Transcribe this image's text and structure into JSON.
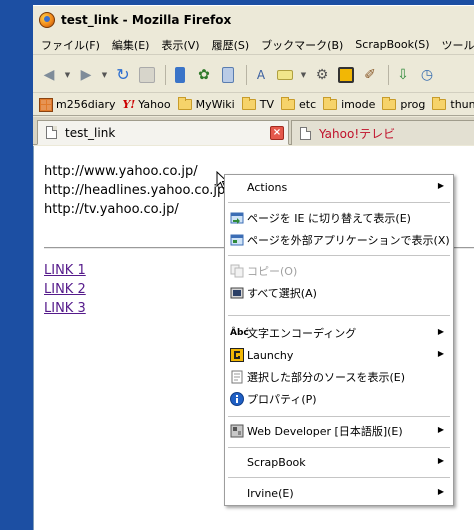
{
  "window": {
    "title": "test_link - Mozilla Firefox"
  },
  "menubar": {
    "items": [
      "ファイル(F)",
      "編集(E)",
      "表示(V)",
      "履歴(S)",
      "ブックマーク(B)",
      "ScrapBook(S)",
      "ツール"
    ]
  },
  "bookmarks": {
    "items": [
      "m256diary",
      "Yahoo",
      "MyWiki",
      "TV",
      "etc",
      "imode",
      "prog",
      "thun"
    ]
  },
  "tabs": {
    "active": "test_link",
    "inactive": "Yahoo!テレビ"
  },
  "page": {
    "urls": [
      "http://www.yahoo.co.jp/",
      "http://headlines.yahoo.co.jp/",
      "http://tv.yahoo.co.jp/"
    ],
    "links": [
      "LINK 1",
      "LINK 2",
      "LINK 3"
    ]
  },
  "context_menu": {
    "actions": "Actions",
    "open_ie": "ページを IE に切り替えて表示(E)",
    "open_external": "ページを外部アプリケーションで表示(X)",
    "copy": "コピー(O)",
    "select_all": "すべて選択(A)",
    "encoding": "文字エンコーディング",
    "launchy": "Launchy",
    "view_source": "選択した部分のソースを表示(E)",
    "properties": "プロパティ(P)",
    "web_developer": "Web Developer [日本語版](E)",
    "scrapbook": "ScrapBook",
    "irvine": "Irvine(E)"
  },
  "colors": {
    "desktop": "#1c4fa3",
    "chrome": "#ece9d8",
    "visited_link": "#551a8b",
    "inactive_tab_text": "#c0102a"
  }
}
